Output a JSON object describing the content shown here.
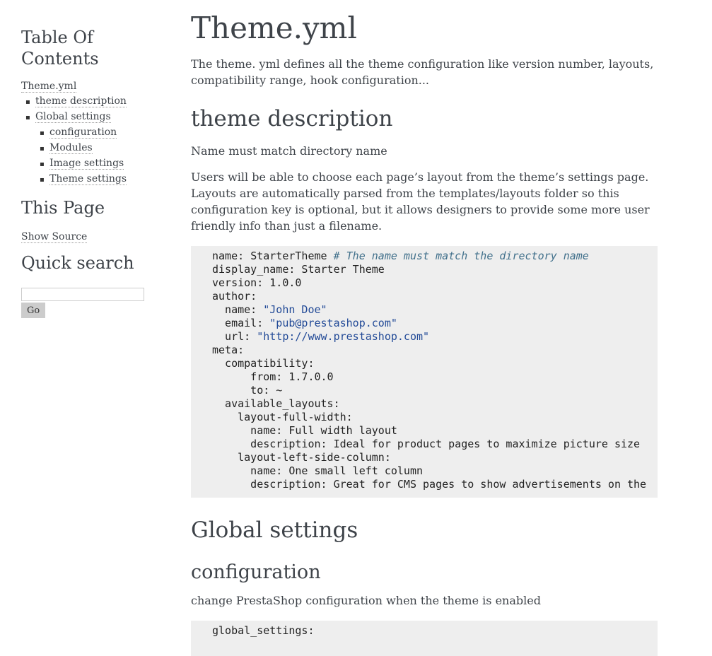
{
  "sidebar": {
    "toc_title": "Table Of Contents",
    "toc": {
      "root": "Theme.yml",
      "items": [
        {
          "label": "theme description"
        },
        {
          "label": "Global settings",
          "children": [
            "configuration",
            "Modules",
            "Image settings",
            "Theme settings"
          ]
        }
      ]
    },
    "this_page_title": "This Page",
    "show_source": "Show Source",
    "quick_search_title": "Quick search",
    "search_value": "",
    "go_label": "Go"
  },
  "main": {
    "title": "Theme.yml",
    "intro": "The theme. yml defines all the theme configuration like version number, layouts, compatibility range, hook configuration...",
    "section1": {
      "heading": "theme description",
      "p1": "Name must match directory name",
      "p2": "Users will be able to choose each page’s layout from the theme’s settings page. Layouts are automatically parsed from the templates/layouts folder so this configuration key is optional, but it allows designers to provide some more user friendly info than just a filename."
    },
    "code1": {
      "name_key": "name: ",
      "name_value": "StarterTheme ",
      "name_comment": "# The name must match the directory name",
      "display_name": "display_name: Starter Theme",
      "version": "version: 1.0.0",
      "author": "author:",
      "author_name_key": "  name: ",
      "author_name_value": "\"John Doe\"",
      "author_email_key": "  email: ",
      "author_email_value": "\"pub@prestashop.com\"",
      "author_url_key": "  url: ",
      "author_url_value": "\"http://www.prestashop.com\"",
      "meta": "meta:",
      "compatibility": "  compatibility:",
      "from": "      from: 1.7.0.0",
      "to": "      to: ~",
      "available_layouts": "  available_layouts:",
      "layout_full": "    layout-full-width:",
      "layout_full_name": "      name: Full width layout",
      "layout_full_desc": "      description: Ideal for product pages to maximize picture size",
      "layout_left": "    layout-left-side-column:",
      "layout_left_name": "      name: One small left column",
      "layout_left_desc": "      description: Great for CMS pages to show advertisements on the"
    },
    "section2": {
      "heading": "Global settings",
      "sub_heading": "configuration",
      "p1": "change PrestaShop configuration when the theme is enabled"
    },
    "code2": {
      "line1": "global_settings:"
    }
  }
}
